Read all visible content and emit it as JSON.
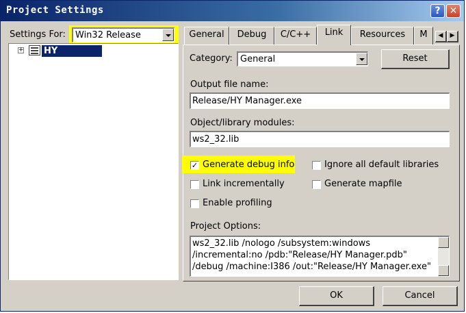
{
  "window": {
    "title": "Project Settings",
    "help_glyph": "?",
    "close_glyph": "✕"
  },
  "left": {
    "settings_for_label": "Settings For:",
    "config_value": "Win32 Release",
    "tree_item": "HY Manager",
    "tree_expander": "+"
  },
  "tabs": [
    "General",
    "Debug",
    "C/C++",
    "Link",
    "Resources",
    "M"
  ],
  "tab_scroll": {
    "left": "◀",
    "right": "▶"
  },
  "link": {
    "category_label": "Category:",
    "category_value": "General",
    "reset_label": "Reset",
    "output_label": "Output file name:",
    "output_value": "Release/HY Manager.exe",
    "modules_label": "Object/library modules:",
    "modules_value": "ws2_32.lib",
    "checkboxes": [
      {
        "label": "Generate debug info",
        "checked": true
      },
      {
        "label": "Ignore all default libraries",
        "checked": false
      },
      {
        "label": "Link incrementally",
        "checked": false
      },
      {
        "label": "Generate mapfile",
        "checked": false
      },
      {
        "label": "Enable profiling",
        "checked": false
      }
    ],
    "options_label": "Project Options:",
    "options_lines": [
      "ws2_32.lib /nologo /subsystem:windows",
      "/incremental:no /pdb:\"Release/HY Manager.pdb\"",
      "/debug /machine:I386 /out:\"Release/HY Manager.exe\""
    ]
  },
  "footer": {
    "ok_label": "OK",
    "cancel_label": "Cancel"
  },
  "colors": {
    "highlight": "#ffff00",
    "selection": "#0a246a",
    "title_bar": "#0a246a"
  }
}
